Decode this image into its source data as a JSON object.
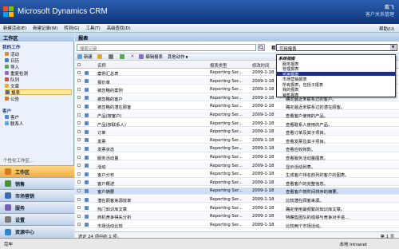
{
  "banner": {
    "title": "Microsoft Dynamics CRM",
    "user": "戴飞",
    "org": "客户关系管理"
  },
  "menubar": {
    "items": [
      "新建活动(E)",
      "新建记录(W)",
      "转到(G)",
      "工具(T)",
      "高级查找(D)"
    ],
    "help": "帮助(U)"
  },
  "left": {
    "header": "工作区",
    "section1": "我的工作",
    "work_items": [
      "活动",
      "日历",
      "导入",
      "重复检测",
      "队列",
      "文章",
      "报表",
      "公告"
    ],
    "section2": "客户",
    "customer_items": [
      "客户",
      "联系人"
    ],
    "personalize": "个性化工作区...",
    "areas": [
      "工作区",
      "销售",
      "市场营销",
      "服务",
      "设置",
      "资源中心"
    ]
  },
  "main": {
    "header": "报表",
    "search_placeholder": "搜索记录",
    "view_label": "视图:",
    "view_selected": "可用报表",
    "toolbar": [
      "新建",
      "编辑报表",
      "其他动作"
    ],
    "columns": [
      "名称",
      "报表类型",
      "修改时间",
      "说明"
    ],
    "rows": [
      {
        "name": "案例汇总表",
        "type": "Reporting Ser...",
        "date": "2009-1-18",
        "desc": ""
      },
      {
        "name": "报价单",
        "type": "Reporting Ser...",
        "date": "2009-1-18",
        "desc": ""
      },
      {
        "name": "被忽略的案例",
        "type": "Reporting Ser...",
        "date": "2009-1-18",
        "desc": ""
      },
      {
        "name": "被忽略的客户",
        "type": "Reporting Ser...",
        "date": "2009-1-18",
        "desc": "确定最近未联系过的客户。"
      },
      {
        "name": "被忽略的潜在顾客",
        "type": "Reporting Ser...",
        "date": "2009-1-18",
        "desc": "确定最近未联系过的潜在顾客。"
      },
      {
        "name": "产品(按客户)",
        "type": "Reporting Ser...",
        "date": "2009-1-18",
        "desc": "查看客户使用的产品。"
      },
      {
        "name": "产品(按联系人)",
        "type": "Reporting Ser...",
        "date": "2009-1-18",
        "desc": "查看联系人使用的产品。"
      },
      {
        "name": "订单",
        "type": "Reporting Ser...",
        "date": "2009-1-18",
        "desc": "查看订单及其子项目。"
      },
      {
        "name": "发票",
        "type": "Reporting Ser...",
        "date": "2009-1-18",
        "desc": "查看发票及其子项目。"
      },
      {
        "name": "发票状态",
        "type": "Reporting Ser...",
        "date": "2009-1-18",
        "desc": "查看应收帐款。"
      },
      {
        "name": "服务活动量",
        "type": "Reporting Ser...",
        "date": "2009-1-18",
        "desc": "查看服务活动量图表。"
      },
      {
        "name": "活动",
        "type": "Reporting Ser...",
        "date": "2009-1-18",
        "desc": "显示活动列表。"
      },
      {
        "name": "客户分布",
        "type": "Reporting Ser...",
        "date": "2009-1-18",
        "desc": "生成客户排名前列的客户的图表。"
      },
      {
        "name": "客户概述",
        "type": "Reporting Ser...",
        "date": "2009-1-18",
        "desc": "查看客户的完整信息。"
      },
      {
        "name": "客户摘要",
        "type": "Reporting Ser...",
        "date": "2009-1-18",
        "desc": "查看客户按时间排序的摘要。"
      },
      {
        "name": "潜在顾客来源效率",
        "type": "Reporting Ser...",
        "date": "2009-1-18",
        "desc": "比较潜在顾客来源。"
      },
      {
        "name": "热门知识库文章",
        "type": "Reporting Ser...",
        "date": "2009-1-18",
        "desc": "确定使用最频繁的知识库文章。"
      },
      {
        "name": "商机竞争得失分析",
        "type": "Reporting Ser...",
        "date": "2009-1-18",
        "desc": "特确售团队的成绩与竞争对手进..."
      },
      {
        "name": "市场活动比较",
        "type": "Reporting Ser...",
        "date": "2009-1-18",
        "desc": "比较两个市场活动。"
      }
    ],
    "footer": "选定 24 项中的 1 项。",
    "pager": "第 1 页"
  },
  "dropdown": {
    "header": "系统视图",
    "items": [
      "服务报表",
      "管理报表",
      "可用报表",
      "市场营销报表",
      "所有报表，包括子报表",
      "我的报表",
      "销售报表"
    ],
    "selected_index": 2
  },
  "status": {
    "left": "完毕",
    "right": "本地 Intranet"
  },
  "colors": {
    "banner": "#1a4595",
    "selection": "#1c2f8a",
    "highlight": "#fbe9a6"
  }
}
